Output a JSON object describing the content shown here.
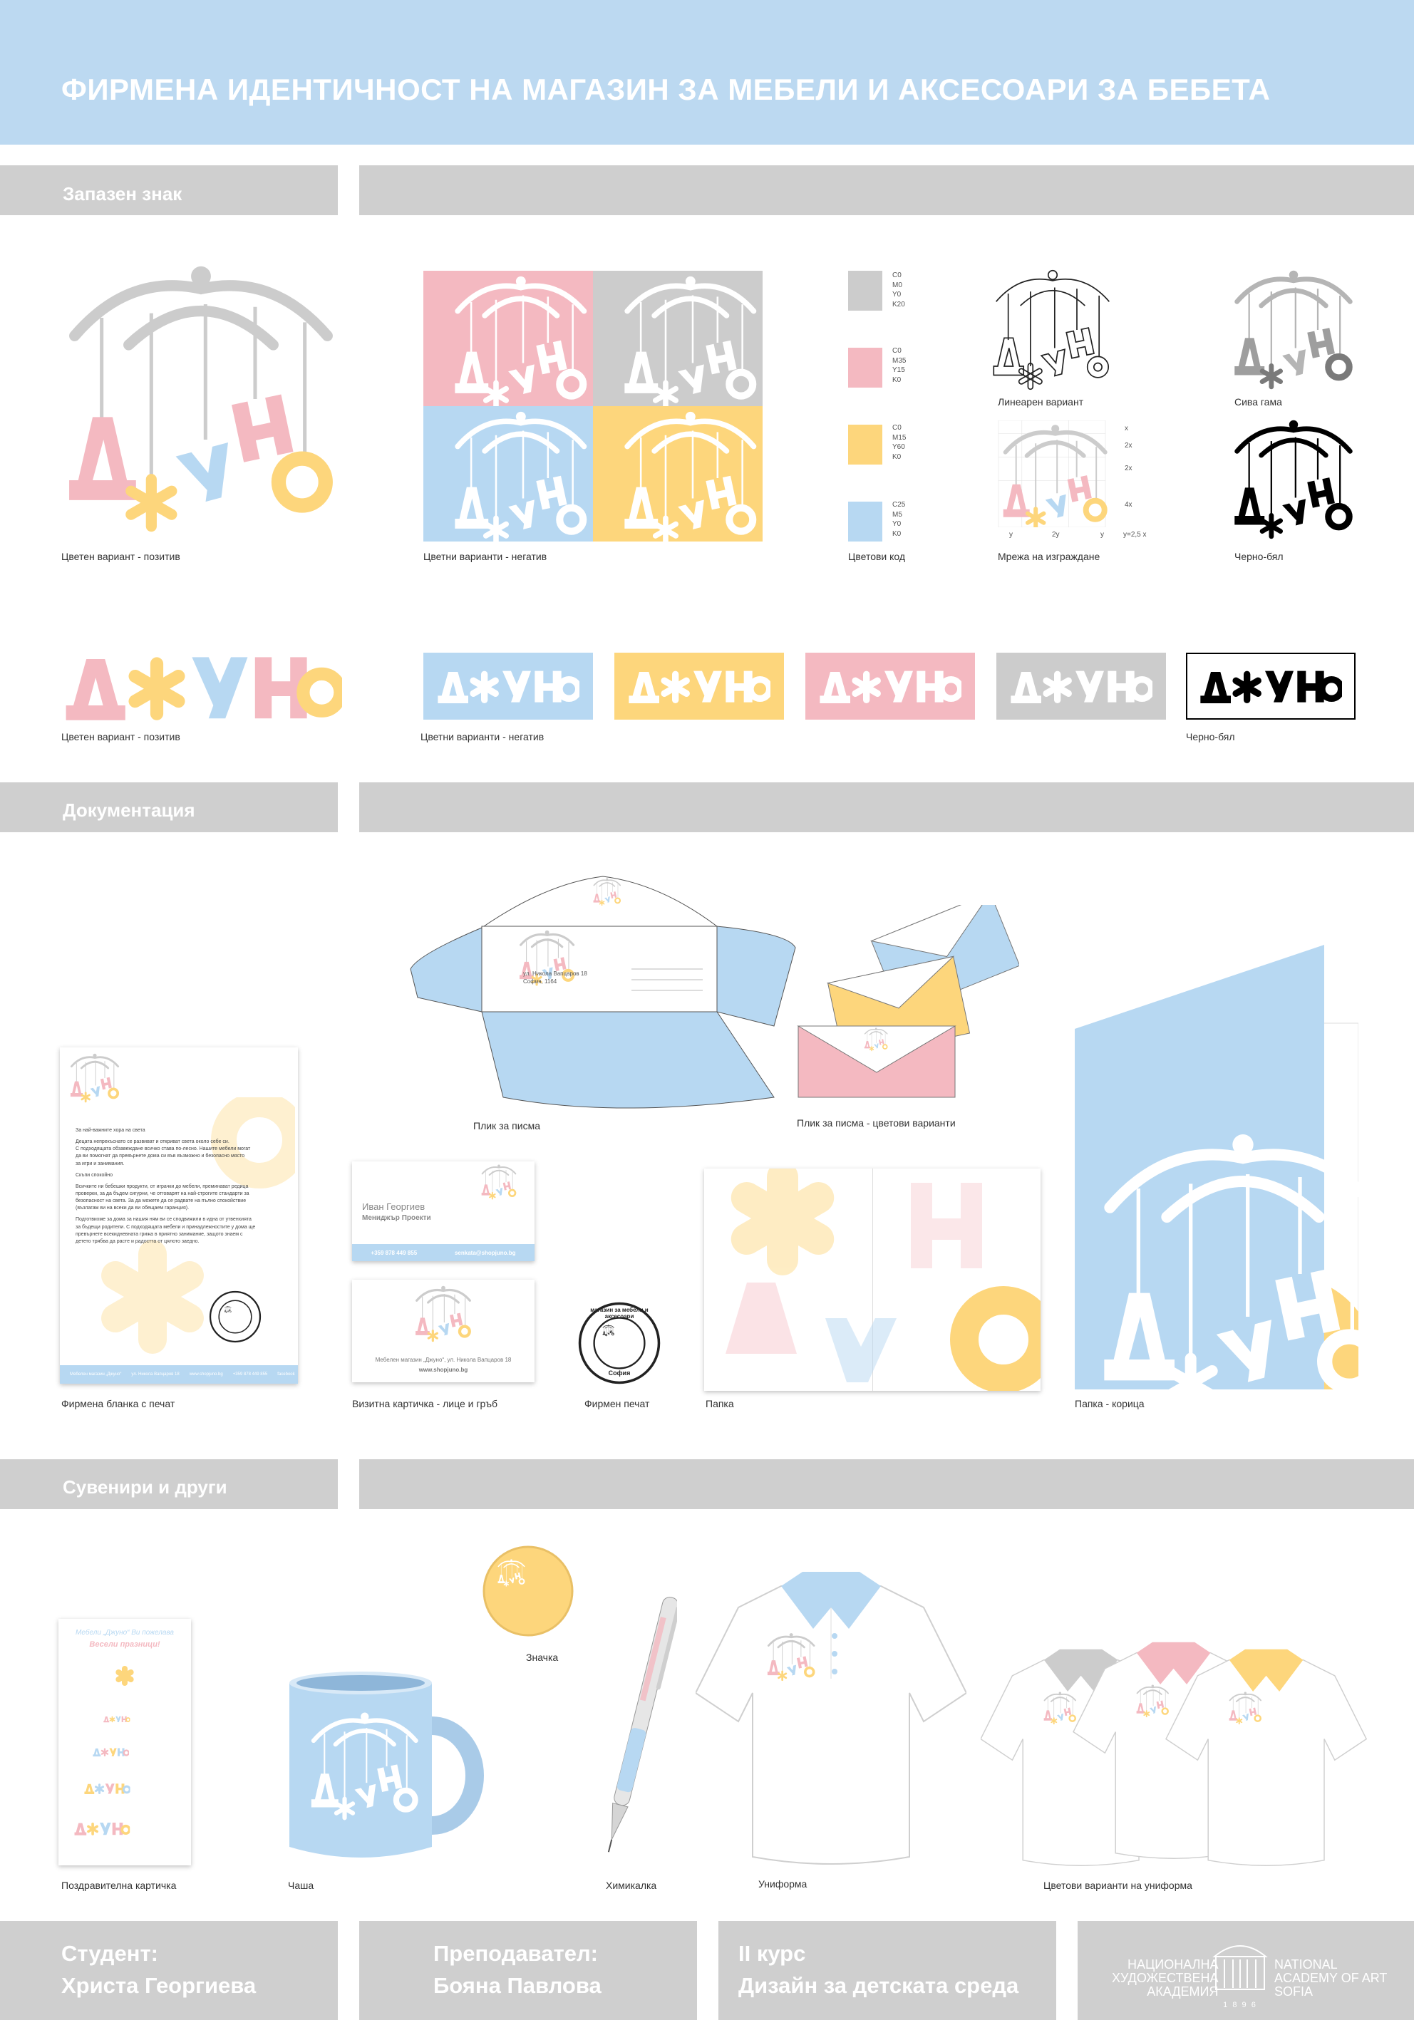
{
  "header": {
    "title": "ФИРМЕНА ИДЕНТИЧНОСТ НА МАГАЗИН ЗА МЕБЕЛИ И АКСЕСОАРИ ЗА БЕБЕТА"
  },
  "brand": {
    "letters": [
      "Д",
      "Ж",
      "У",
      "Н",
      "О"
    ],
    "wordmark": "ДЖУНО"
  },
  "colors": {
    "pink": "#f4b9c1",
    "yellow": "#fdd67c",
    "blue": "#b7d8f2",
    "gray": "#cccccc",
    "black": "#000000"
  },
  "sections": {
    "trademark": "Запазен знак",
    "documentation": "Документация",
    "souvenirs": "Сувенири и други"
  },
  "trademark": {
    "color_positive": "Цветен вариант - позитив",
    "color_negative": "Цветни варианти - негатив",
    "color_code": "Цветови код",
    "linear": "Линеарен вариант",
    "grid": "Мрежа на изграждане",
    "grayscale": "Сива гама",
    "bw": "Черно-бял",
    "wordmark_positive": "Цветен вариант - позитив",
    "wordmark_negative": "Цветни варианти - негатив",
    "wordmark_bw": "Черно-бял",
    "swatches": [
      {
        "code": [
          "C0",
          "M0",
          "Y0",
          "K20"
        ],
        "color": "#cccccc"
      },
      {
        "code": [
          "C0",
          "M35",
          "Y15",
          "K0"
        ],
        "color": "#f4b9c1"
      },
      {
        "code": [
          "C0",
          "M15",
          "Y60",
          "K0"
        ],
        "color": "#fdd67c"
      },
      {
        "code": [
          "C25",
          "M5",
          "Y0",
          "K0"
        ],
        "color": "#b7d8f2"
      }
    ],
    "grid_labels": {
      "right": [
        "x",
        "2x",
        "2x",
        "4x"
      ],
      "bottom": [
        "y",
        "2y",
        "y",
        "y=2,5 x"
      ]
    }
  },
  "documentation": {
    "envelope": "Плик за писма",
    "envelope_colors": "Плик за писма - цветови варианти",
    "letterhead": "Фирмена бланка с печат",
    "business_card": "Визитна картичка - лице и гръб",
    "stamp": "Фирмен печат",
    "folder": "Папка",
    "folder_cover": "Папка - корица",
    "card_name": "Иван Георгиев",
    "card_role": "Мениджър Проекти",
    "card_phone": "+359 878 449 855",
    "card_email": "senkata@shopjuno.bg",
    "card_address": "Мебелен магазин „Джуно“, ул. Никола Вапцаров 18",
    "card_web": "www.shopjuno.bg",
    "stamp_ring": "магазин за мебели и аксесоари",
    "stamp_city": "София",
    "envelope_address": [
      "ул. Никола Вапцаров 18",
      "София, 1164"
    ],
    "letter_greeting": "За най-важните хора на света",
    "letter_body": [
      "Децата непрекъснато се развиват и откриват света около себе си.",
      "С подходящата обзавеждане всичко става по-лесно. Нашите мебели могат",
      "да ви помогнат да превърнете дома си във възможно и безопасно място",
      "за игри и занимания.",
      "",
      "Скъпи спокойно",
      "",
      "Всичките ни бебешки продукти, от играчки до мебели, преминават редица",
      "проверки, за да бъдем сигурни, че отговарят на най-строгите стандарти за",
      "безопасност на света. За да можете да се радвате на пълно спокойствие",
      "(възлагам ви на всеки да ви обещаем гаранция).",
      "",
      "Подготвихме за дома за нашия ням ви се сподвижили в идна от утвенхията",
      "за бъдещи родители. С подходящата мебели и принадлежностите у дома ще",
      "превърнете всекидневната грижа в приятно занимание, защото знаем с",
      "детето трябва да расте и радостта от цялото заедно."
    ],
    "letter_footer": [
      "Мебелен магазин „Джуно“",
      "ул. Никола Вапцаров 18",
      "www.shopjuno.bg",
      "+359 878 449 855",
      "facebook"
    ]
  },
  "souvenirs": {
    "greeting_card": "Поздравителна картичка",
    "greeting_line1": "Мебели „Джуно“ Ви пожелава",
    "greeting_line2": "Весели празници!",
    "mug": "Чаша",
    "badge": "Значка",
    "pen": "Химикалка",
    "uniform": "Униформа",
    "uniform_colors": "Цветови варианти на униформа"
  },
  "footer": {
    "student_label": "Студент:",
    "student_name": "Христа Георгиева",
    "teacher_label": "Преподавател:",
    "teacher_name": "Бояна Павлова",
    "course": "II курс",
    "subject": "Дизайн за детската среда",
    "academy_bg": [
      "НАЦИОНАЛНА",
      "ХУДОЖЕСТВЕНА",
      "АКАДЕМИЯ"
    ],
    "academy_en": [
      "NATIONAL",
      "ACADEMY OF ART",
      "SOFIA"
    ],
    "year": "1 8 9 6"
  }
}
